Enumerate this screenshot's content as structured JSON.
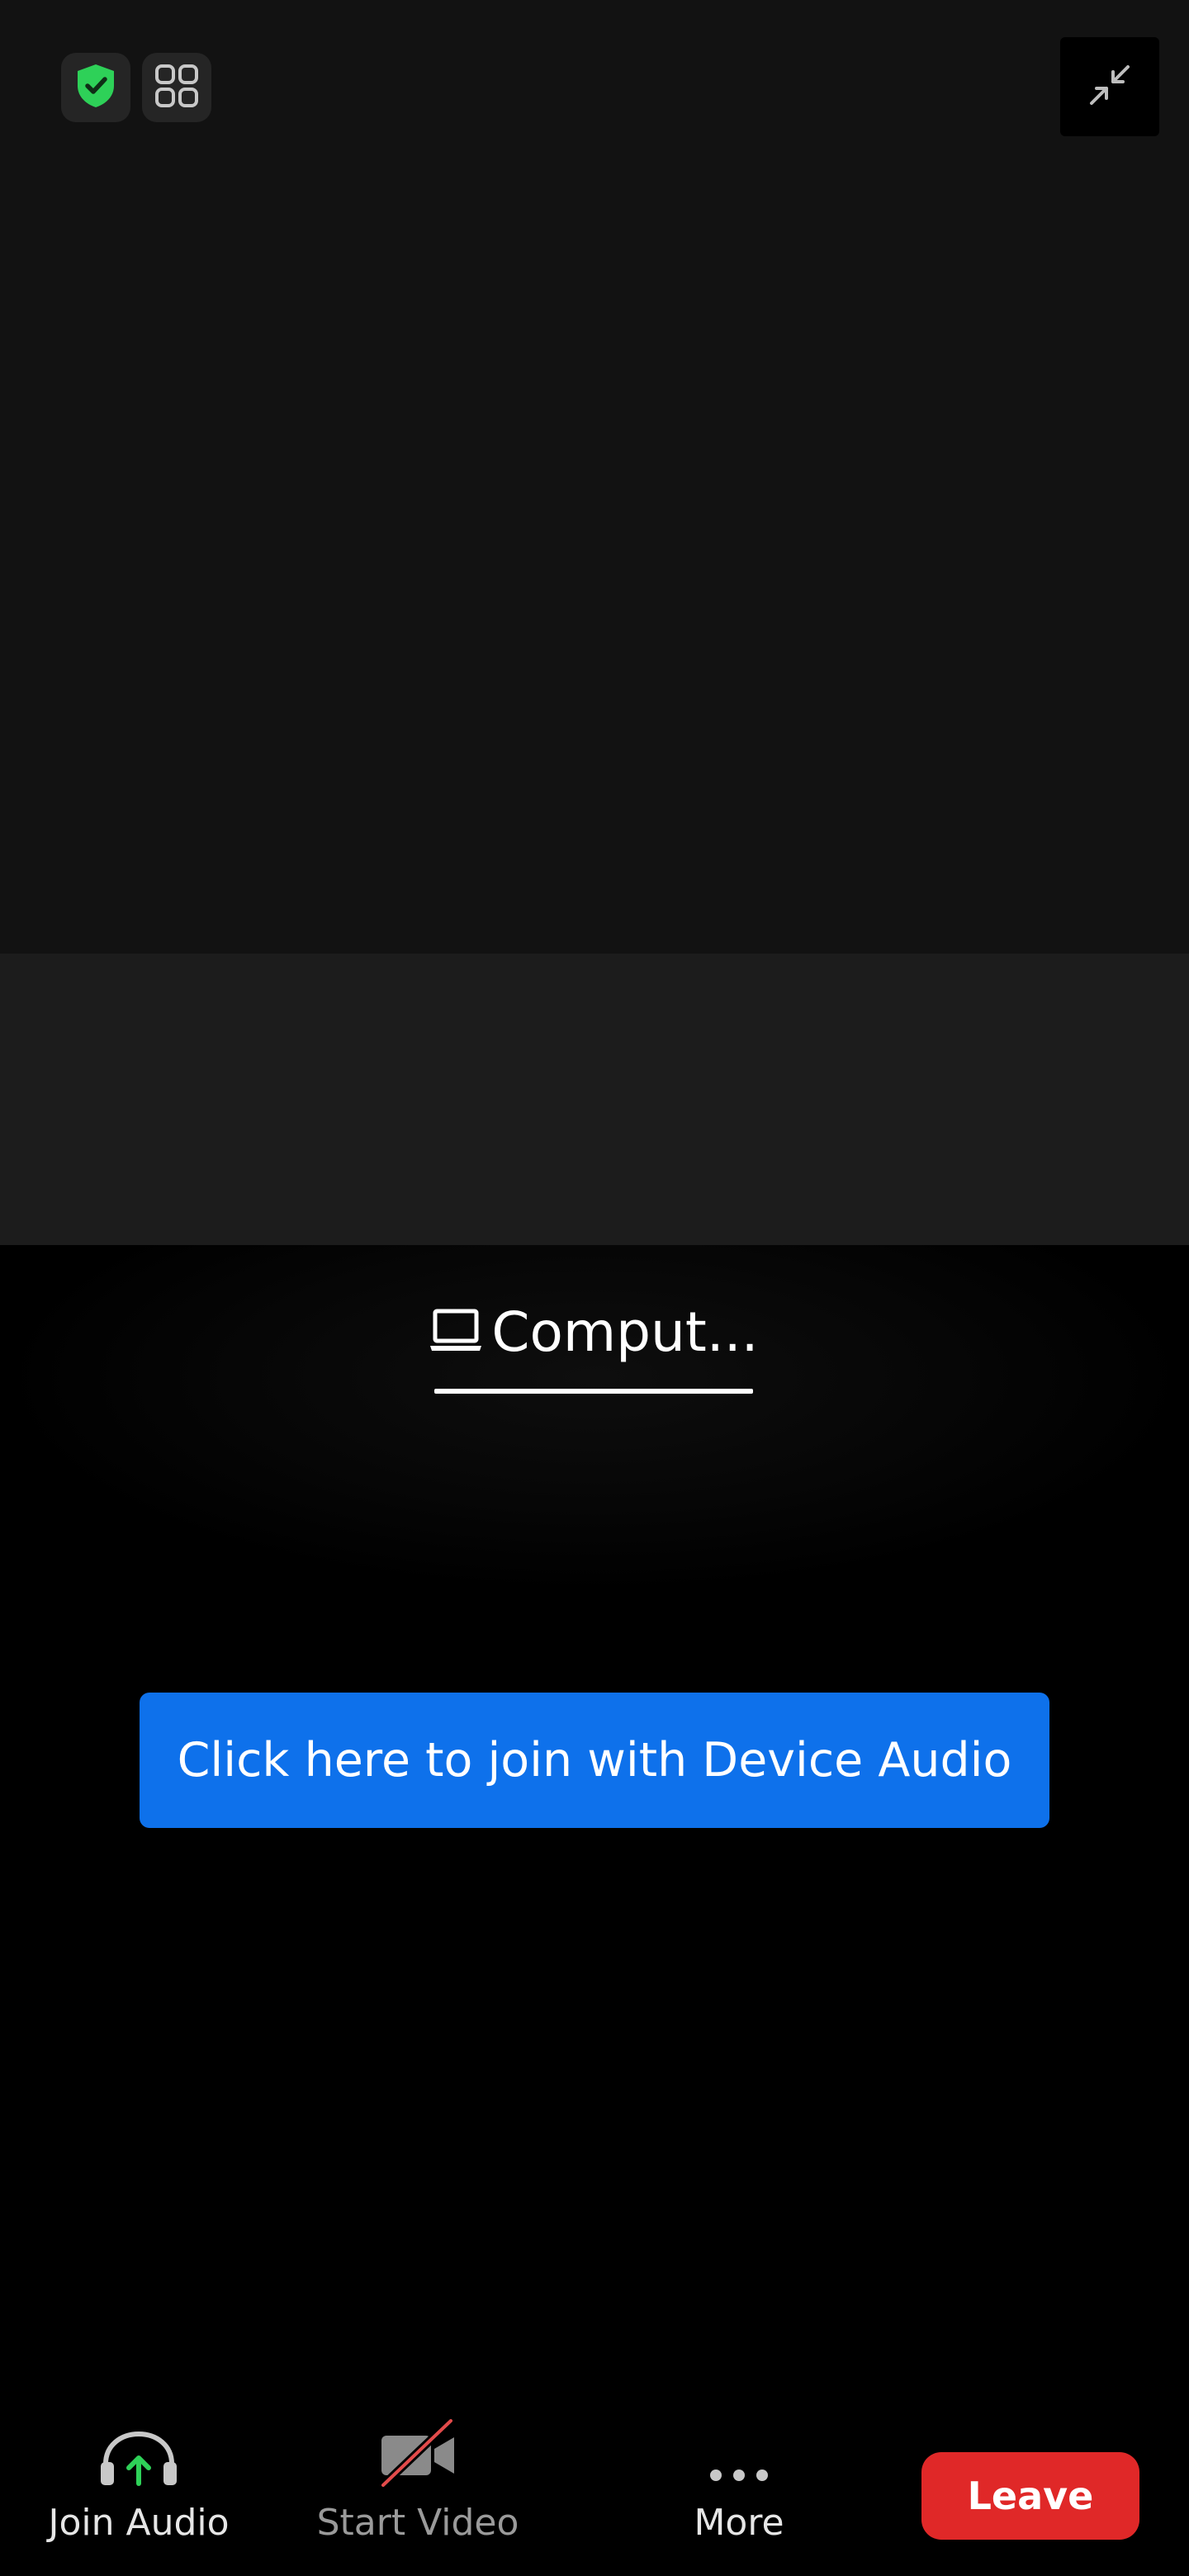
{
  "audio_panel": {
    "tab_label": "Comput...",
    "join_button_label": "Click here to join with Device Audio"
  },
  "toolbar": {
    "join_audio_label": "Join Audio",
    "start_video_label": "Start Video",
    "more_label": "More",
    "leave_label": "Leave"
  },
  "icons": {
    "security": "shield-check-icon",
    "layout": "grid-view-icon",
    "minimize": "minimize-arrows-icon",
    "computer": "laptop-icon",
    "join_audio": "headphones-arrow-up-icon",
    "start_video": "video-off-icon",
    "more": "ellipsis-icon"
  },
  "colors": {
    "security_green": "#2ed158",
    "primary_blue": "#0e71eb",
    "leave_red": "#e02828",
    "video_off_slash": "#e24b4b"
  }
}
